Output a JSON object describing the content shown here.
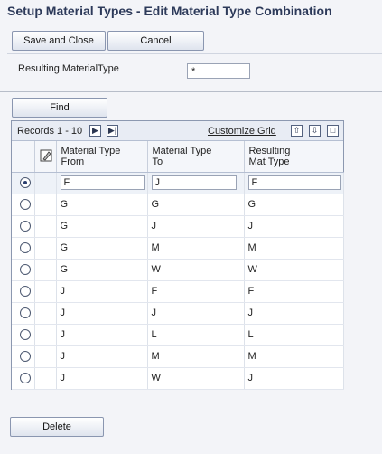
{
  "header": {
    "title": "Setup Material Types - Edit Material Type Combination"
  },
  "toolbar": {
    "save_close_label": "Save and Close",
    "cancel_label": "Cancel"
  },
  "form": {
    "resulting_label": "Resulting MaterialType",
    "resulting_value": "*"
  },
  "find_label": "Find",
  "grid": {
    "records_label": "Records  1 - 10",
    "customize_label": "Customize Grid",
    "columns": {
      "from": "Material Type From",
      "to": "Material Type To",
      "result": "Resulting Mat Type"
    },
    "column_lines": {
      "from1": "Material Type",
      "from2": "From",
      "to1": "Material Type",
      "to2": "To",
      "result1": "Resulting",
      "result2": "Mat Type"
    },
    "rows": [
      {
        "from": "F",
        "to": "J",
        "result": "F"
      },
      {
        "from": "G",
        "to": "G",
        "result": "G"
      },
      {
        "from": "G",
        "to": "J",
        "result": "J"
      },
      {
        "from": "G",
        "to": "M",
        "result": "M"
      },
      {
        "from": "G",
        "to": "W",
        "result": "W"
      },
      {
        "from": "J",
        "to": "F",
        "result": "F"
      },
      {
        "from": "J",
        "to": "J",
        "result": "J"
      },
      {
        "from": "J",
        "to": "L",
        "result": "L"
      },
      {
        "from": "J",
        "to": "M",
        "result": "M"
      },
      {
        "from": "J",
        "to": "W",
        "result": "J"
      }
    ]
  },
  "delete_label": "Delete",
  "colors": {
    "title": "#2d3a5a",
    "background": "#f3f4f8",
    "grid_border": "#8c98b0"
  }
}
